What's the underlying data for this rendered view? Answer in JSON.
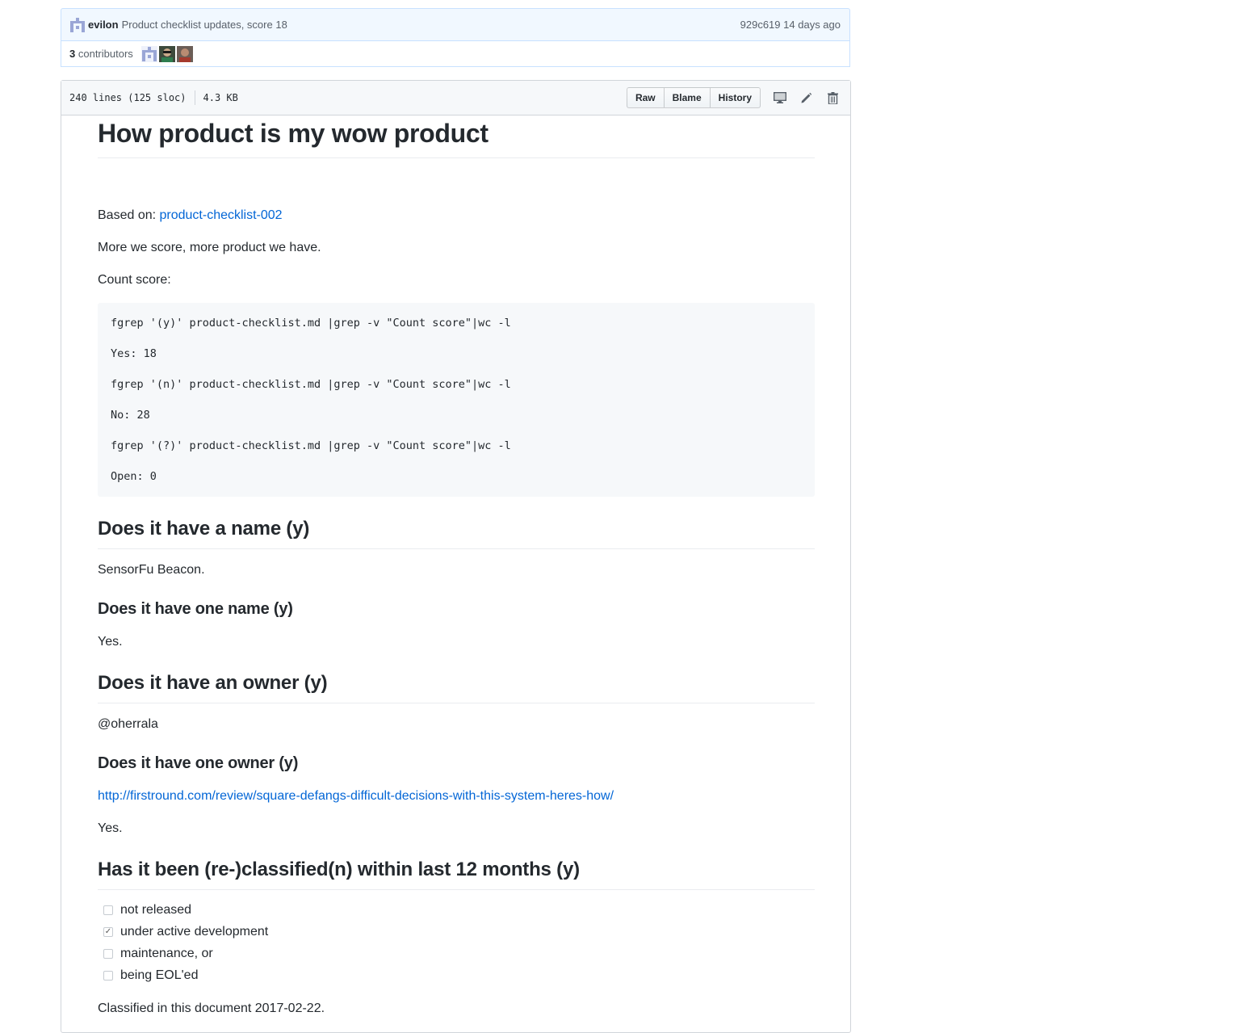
{
  "commit": {
    "author": "evilon",
    "message": "Product checklist updates, score 18",
    "sha": "929c619",
    "age": "14 days ago"
  },
  "contributors": {
    "count": "3",
    "label": "contributors"
  },
  "file": {
    "lines": "240 lines (125 sloc)",
    "size": "4.3 KB",
    "buttons": {
      "raw": "Raw",
      "blame": "Blame",
      "history": "History"
    },
    "icons": [
      "desktop-icon",
      "pencil-icon",
      "trash-icon"
    ]
  },
  "doc": {
    "title": "How product is my wow product",
    "based_on_label": "Based on: ",
    "based_on_link": "product-checklist-002",
    "intro": "More we score, more product we have.",
    "count_score": "Count score:",
    "code_lines": [
      "fgrep '(y)' product-checklist.md |grep -v \"Count score\"|wc -l",
      "Yes: 18",
      "fgrep '(n)' product-checklist.md |grep -v \"Count score\"|wc -l",
      "No: 28",
      "fgrep '(?)' product-checklist.md |grep -v \"Count score\"|wc -l",
      "Open: 0"
    ],
    "h_name": "Does it have a name (y)",
    "name_value": "SensorFu Beacon.",
    "h_one_name": "Does it have one name (y)",
    "one_name_value": "Yes.",
    "h_owner": "Does it have an owner (y)",
    "owner_value": "@oherrala",
    "h_one_owner": "Does it have one owner (y)",
    "one_owner_link": "http://firstround.com/review/square-defangs-difficult-decisions-with-this-system-heres-how/",
    "one_owner_value": "Yes.",
    "h_classified": "Has it been (re-)classified(n) within last 12 months (y)",
    "tasks": [
      {
        "label": "not released",
        "checked": false
      },
      {
        "label": "under active development",
        "checked": true
      },
      {
        "label": "maintenance, or",
        "checked": false
      },
      {
        "label": "being EOL'ed",
        "checked": false
      }
    ],
    "classified_note": "Classified in this document 2017-02-22."
  }
}
